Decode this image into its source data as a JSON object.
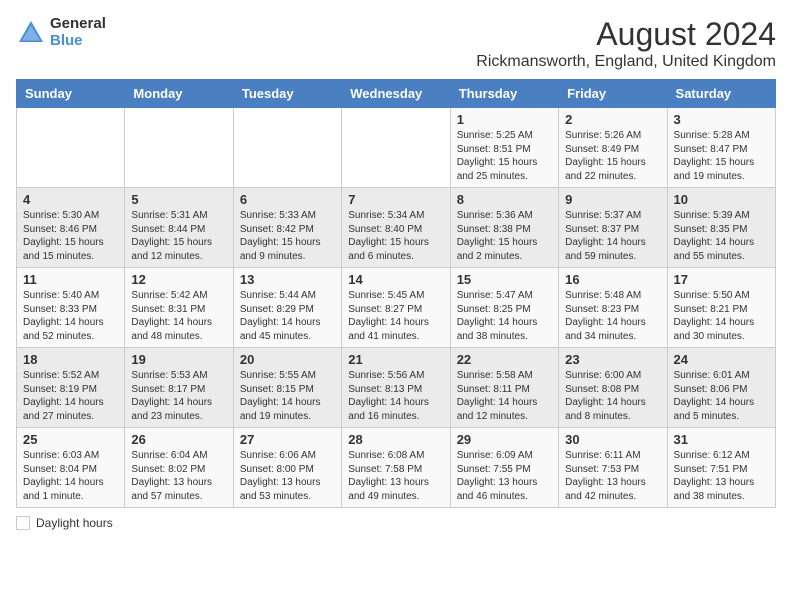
{
  "header": {
    "logo_general": "General",
    "logo_blue": "Blue",
    "month_title": "August 2024",
    "location": "Rickmansworth, England, United Kingdom"
  },
  "columns": [
    "Sunday",
    "Monday",
    "Tuesday",
    "Wednesday",
    "Thursday",
    "Friday",
    "Saturday"
  ],
  "weeks": [
    [
      {
        "day": "",
        "sunrise": "",
        "sunset": "",
        "daylight": ""
      },
      {
        "day": "",
        "sunrise": "",
        "sunset": "",
        "daylight": ""
      },
      {
        "day": "",
        "sunrise": "",
        "sunset": "",
        "daylight": ""
      },
      {
        "day": "",
        "sunrise": "",
        "sunset": "",
        "daylight": ""
      },
      {
        "day": "1",
        "sunrise": "Sunrise: 5:25 AM",
        "sunset": "Sunset: 8:51 PM",
        "daylight": "Daylight: 15 hours and 25 minutes."
      },
      {
        "day": "2",
        "sunrise": "Sunrise: 5:26 AM",
        "sunset": "Sunset: 8:49 PM",
        "daylight": "Daylight: 15 hours and 22 minutes."
      },
      {
        "day": "3",
        "sunrise": "Sunrise: 5:28 AM",
        "sunset": "Sunset: 8:47 PM",
        "daylight": "Daylight: 15 hours and 19 minutes."
      }
    ],
    [
      {
        "day": "4",
        "sunrise": "Sunrise: 5:30 AM",
        "sunset": "Sunset: 8:46 PM",
        "daylight": "Daylight: 15 hours and 15 minutes."
      },
      {
        "day": "5",
        "sunrise": "Sunrise: 5:31 AM",
        "sunset": "Sunset: 8:44 PM",
        "daylight": "Daylight: 15 hours and 12 minutes."
      },
      {
        "day": "6",
        "sunrise": "Sunrise: 5:33 AM",
        "sunset": "Sunset: 8:42 PM",
        "daylight": "Daylight: 15 hours and 9 minutes."
      },
      {
        "day": "7",
        "sunrise": "Sunrise: 5:34 AM",
        "sunset": "Sunset: 8:40 PM",
        "daylight": "Daylight: 15 hours and 6 minutes."
      },
      {
        "day": "8",
        "sunrise": "Sunrise: 5:36 AM",
        "sunset": "Sunset: 8:38 PM",
        "daylight": "Daylight: 15 hours and 2 minutes."
      },
      {
        "day": "9",
        "sunrise": "Sunrise: 5:37 AM",
        "sunset": "Sunset: 8:37 PM",
        "daylight": "Daylight: 14 hours and 59 minutes."
      },
      {
        "day": "10",
        "sunrise": "Sunrise: 5:39 AM",
        "sunset": "Sunset: 8:35 PM",
        "daylight": "Daylight: 14 hours and 55 minutes."
      }
    ],
    [
      {
        "day": "11",
        "sunrise": "Sunrise: 5:40 AM",
        "sunset": "Sunset: 8:33 PM",
        "daylight": "Daylight: 14 hours and 52 minutes."
      },
      {
        "day": "12",
        "sunrise": "Sunrise: 5:42 AM",
        "sunset": "Sunset: 8:31 PM",
        "daylight": "Daylight: 14 hours and 48 minutes."
      },
      {
        "day": "13",
        "sunrise": "Sunrise: 5:44 AM",
        "sunset": "Sunset: 8:29 PM",
        "daylight": "Daylight: 14 hours and 45 minutes."
      },
      {
        "day": "14",
        "sunrise": "Sunrise: 5:45 AM",
        "sunset": "Sunset: 8:27 PM",
        "daylight": "Daylight: 14 hours and 41 minutes."
      },
      {
        "day": "15",
        "sunrise": "Sunrise: 5:47 AM",
        "sunset": "Sunset: 8:25 PM",
        "daylight": "Daylight: 14 hours and 38 minutes."
      },
      {
        "day": "16",
        "sunrise": "Sunrise: 5:48 AM",
        "sunset": "Sunset: 8:23 PM",
        "daylight": "Daylight: 14 hours and 34 minutes."
      },
      {
        "day": "17",
        "sunrise": "Sunrise: 5:50 AM",
        "sunset": "Sunset: 8:21 PM",
        "daylight": "Daylight: 14 hours and 30 minutes."
      }
    ],
    [
      {
        "day": "18",
        "sunrise": "Sunrise: 5:52 AM",
        "sunset": "Sunset: 8:19 PM",
        "daylight": "Daylight: 14 hours and 27 minutes."
      },
      {
        "day": "19",
        "sunrise": "Sunrise: 5:53 AM",
        "sunset": "Sunset: 8:17 PM",
        "daylight": "Daylight: 14 hours and 23 minutes."
      },
      {
        "day": "20",
        "sunrise": "Sunrise: 5:55 AM",
        "sunset": "Sunset: 8:15 PM",
        "daylight": "Daylight: 14 hours and 19 minutes."
      },
      {
        "day": "21",
        "sunrise": "Sunrise: 5:56 AM",
        "sunset": "Sunset: 8:13 PM",
        "daylight": "Daylight: 14 hours and 16 minutes."
      },
      {
        "day": "22",
        "sunrise": "Sunrise: 5:58 AM",
        "sunset": "Sunset: 8:11 PM",
        "daylight": "Daylight: 14 hours and 12 minutes."
      },
      {
        "day": "23",
        "sunrise": "Sunrise: 6:00 AM",
        "sunset": "Sunset: 8:08 PM",
        "daylight": "Daylight: 14 hours and 8 minutes."
      },
      {
        "day": "24",
        "sunrise": "Sunrise: 6:01 AM",
        "sunset": "Sunset: 8:06 PM",
        "daylight": "Daylight: 14 hours and 5 minutes."
      }
    ],
    [
      {
        "day": "25",
        "sunrise": "Sunrise: 6:03 AM",
        "sunset": "Sunset: 8:04 PM",
        "daylight": "Daylight: 14 hours and 1 minute."
      },
      {
        "day": "26",
        "sunrise": "Sunrise: 6:04 AM",
        "sunset": "Sunset: 8:02 PM",
        "daylight": "Daylight: 13 hours and 57 minutes."
      },
      {
        "day": "27",
        "sunrise": "Sunrise: 6:06 AM",
        "sunset": "Sunset: 8:00 PM",
        "daylight": "Daylight: 13 hours and 53 minutes."
      },
      {
        "day": "28",
        "sunrise": "Sunrise: 6:08 AM",
        "sunset": "Sunset: 7:58 PM",
        "daylight": "Daylight: 13 hours and 49 minutes."
      },
      {
        "day": "29",
        "sunrise": "Sunrise: 6:09 AM",
        "sunset": "Sunset: 7:55 PM",
        "daylight": "Daylight: 13 hours and 46 minutes."
      },
      {
        "day": "30",
        "sunrise": "Sunrise: 6:11 AM",
        "sunset": "Sunset: 7:53 PM",
        "daylight": "Daylight: 13 hours and 42 minutes."
      },
      {
        "day": "31",
        "sunrise": "Sunrise: 6:12 AM",
        "sunset": "Sunset: 7:51 PM",
        "daylight": "Daylight: 13 hours and 38 minutes."
      }
    ]
  ],
  "legend": {
    "daylight_label": "Daylight hours"
  }
}
